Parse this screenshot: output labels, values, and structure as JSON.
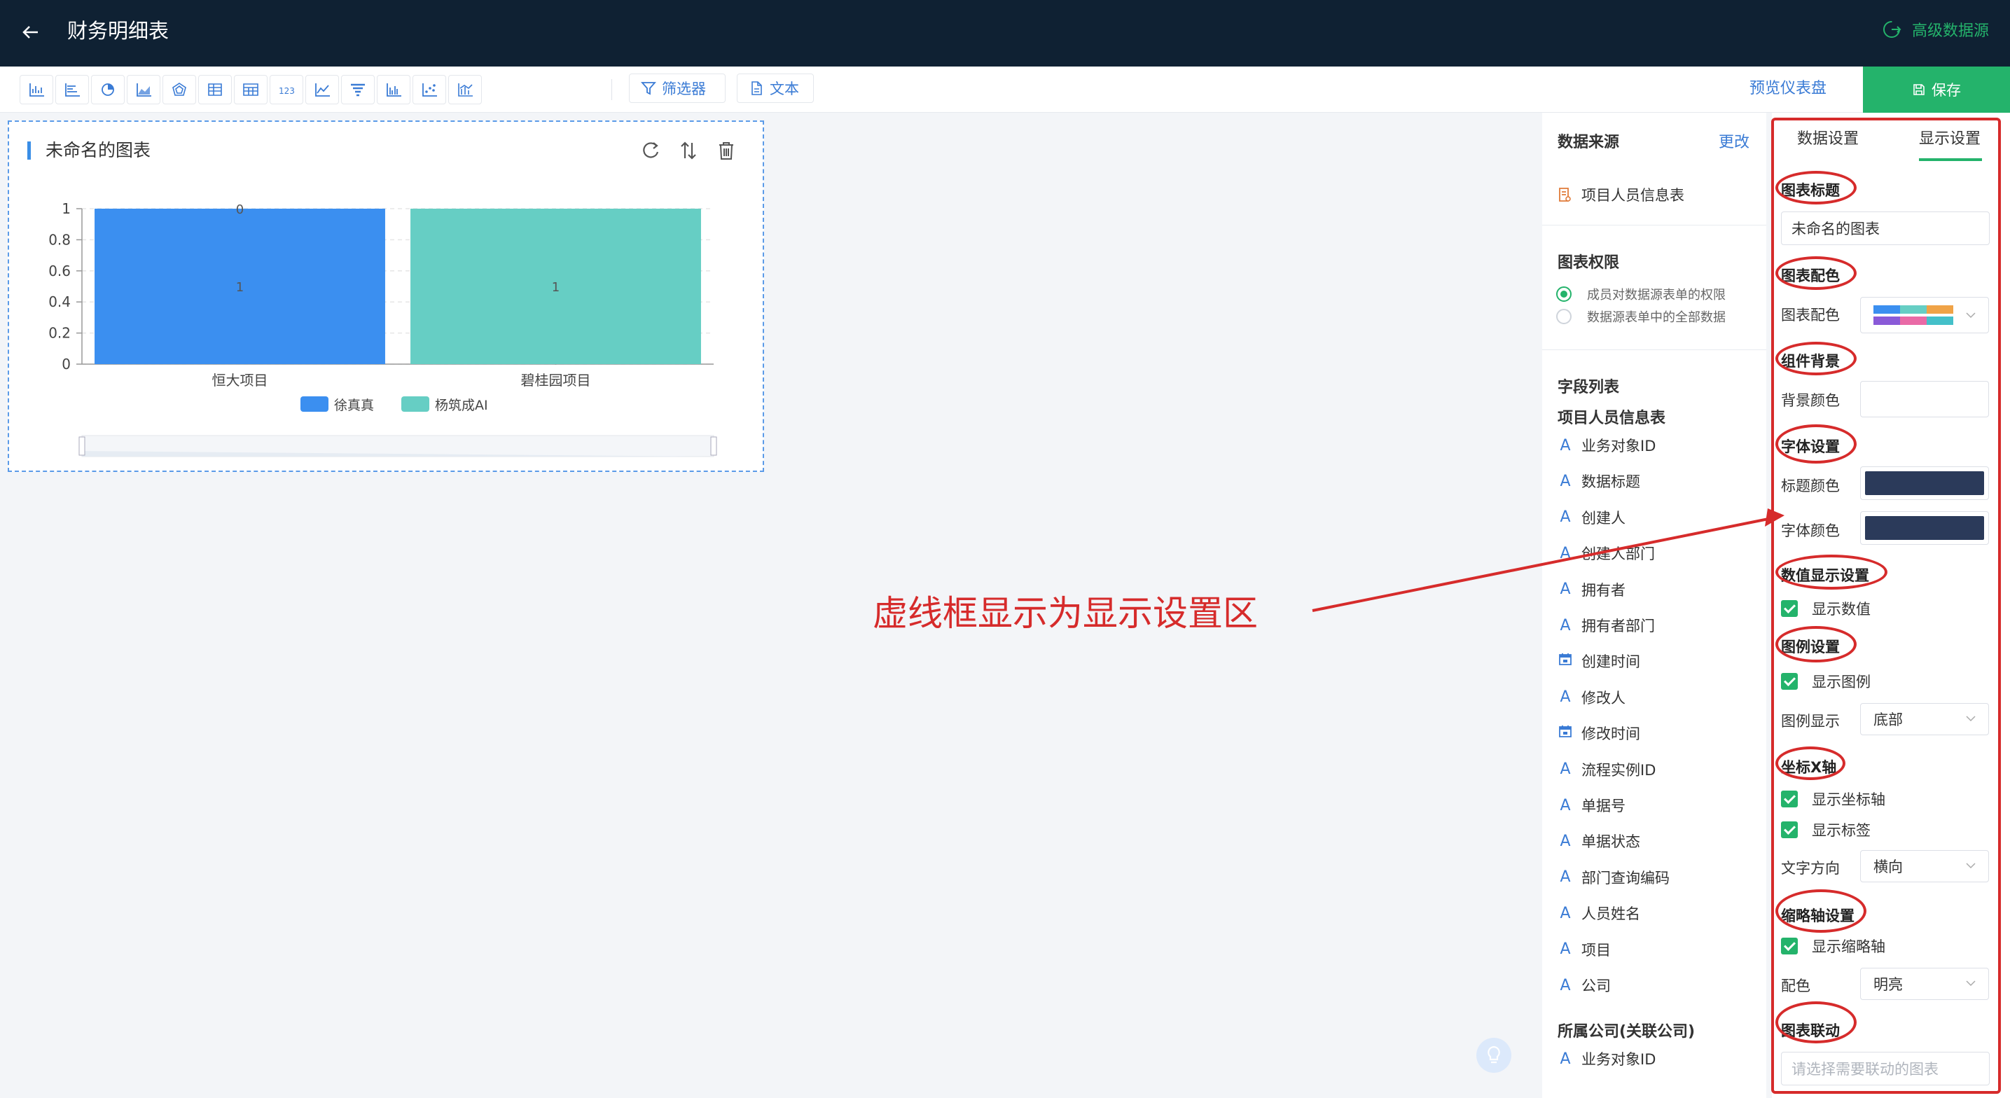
{
  "header": {
    "title": "财务明细表",
    "advanced_source": "高级数据源"
  },
  "toolbar": {
    "filter_label": "筛选器",
    "text_label": "文本",
    "preview_label": "预览仪表盘",
    "save_label": "保存"
  },
  "chart_card": {
    "title": "未命名的图表"
  },
  "chart_data": {
    "type": "bar",
    "categories": [
      "恒大项目",
      "碧桂园项目"
    ],
    "series": [
      {
        "name": "徐真真",
        "values": [
          1,
          0
        ],
        "color": "#3b8ff0"
      },
      {
        "name": "杨筑成AI",
        "values": [
          0,
          1
        ],
        "color": "#66cec4"
      }
    ],
    "yticks": [
      "0",
      "0.2",
      "0.4",
      "0.6",
      "0.8",
      "1"
    ],
    "ylim": [
      0,
      1
    ],
    "stacked": true,
    "data_labels": true,
    "legend": "bottom",
    "datazoom": true,
    "grid": true
  },
  "data_source": {
    "title": "数据来源",
    "change": "更改",
    "table_name": "项目人员信息表",
    "permission_title": "图表权限",
    "permission_options": [
      "成员对数据源表单的权限",
      "数据源表单中的全部数据"
    ],
    "field_list_title": "字段列表",
    "group1_title": "项目人员信息表",
    "fields": [
      {
        "label": "业务对象ID",
        "icon": "text"
      },
      {
        "label": "数据标题",
        "icon": "text"
      },
      {
        "label": "创建人",
        "icon": "text"
      },
      {
        "label": "创建人部门",
        "icon": "text"
      },
      {
        "label": "拥有者",
        "icon": "text"
      },
      {
        "label": "拥有者部门",
        "icon": "text"
      },
      {
        "label": "创建时间",
        "icon": "date"
      },
      {
        "label": "修改人",
        "icon": "text"
      },
      {
        "label": "修改时间",
        "icon": "date"
      },
      {
        "label": "流程实例ID",
        "icon": "text"
      },
      {
        "label": "单据号",
        "icon": "text"
      },
      {
        "label": "单据状态",
        "icon": "text"
      },
      {
        "label": "部门查询编码",
        "icon": "text"
      },
      {
        "label": "人员姓名",
        "icon": "text"
      },
      {
        "label": "项目",
        "icon": "text"
      },
      {
        "label": "公司",
        "icon": "text"
      }
    ],
    "group2_title": "所属公司(关联公司)",
    "group2_fields": [
      "业务对象ID"
    ]
  },
  "settings": {
    "tab_data": "数据设置",
    "tab_display": "显示设置",
    "sec_title": "图表标题",
    "title_value": "未命名的图表",
    "sec_palette": "图表配色",
    "palette_label": "图表配色",
    "sec_bg": "组件背景",
    "bg_label": "背景颜色",
    "sec_font": "字体设置",
    "title_color_label": "标题颜色",
    "font_color_label": "字体颜色",
    "font_color": "#2b3a5a",
    "sec_value": "数值显示设置",
    "show_value": "显示数值",
    "sec_legend": "图例设置",
    "show_legend": "显示图例",
    "legend_pos_label": "图例显示",
    "legend_pos_value": "底部",
    "sec_xaxis": "坐标X轴",
    "show_axis": "显示坐标轴",
    "show_tick_label": "显示标签",
    "text_dir_label": "文字方向",
    "text_dir_value": "横向",
    "sec_zoom": "缩略轴设置",
    "show_zoom": "显示缩略轴",
    "zoom_color_label": "配色",
    "zoom_color_value": "明亮",
    "sec_link": "图表联动",
    "link_placeholder": "请选择需要联动的图表"
  },
  "annotation": {
    "text": "虚线框显示为显示设置区"
  },
  "colors": {
    "header_bg": "#0f2133",
    "accent_green": "#24b36b",
    "link_blue": "#3a7bd5",
    "annotation_red": "#d62b2b"
  }
}
